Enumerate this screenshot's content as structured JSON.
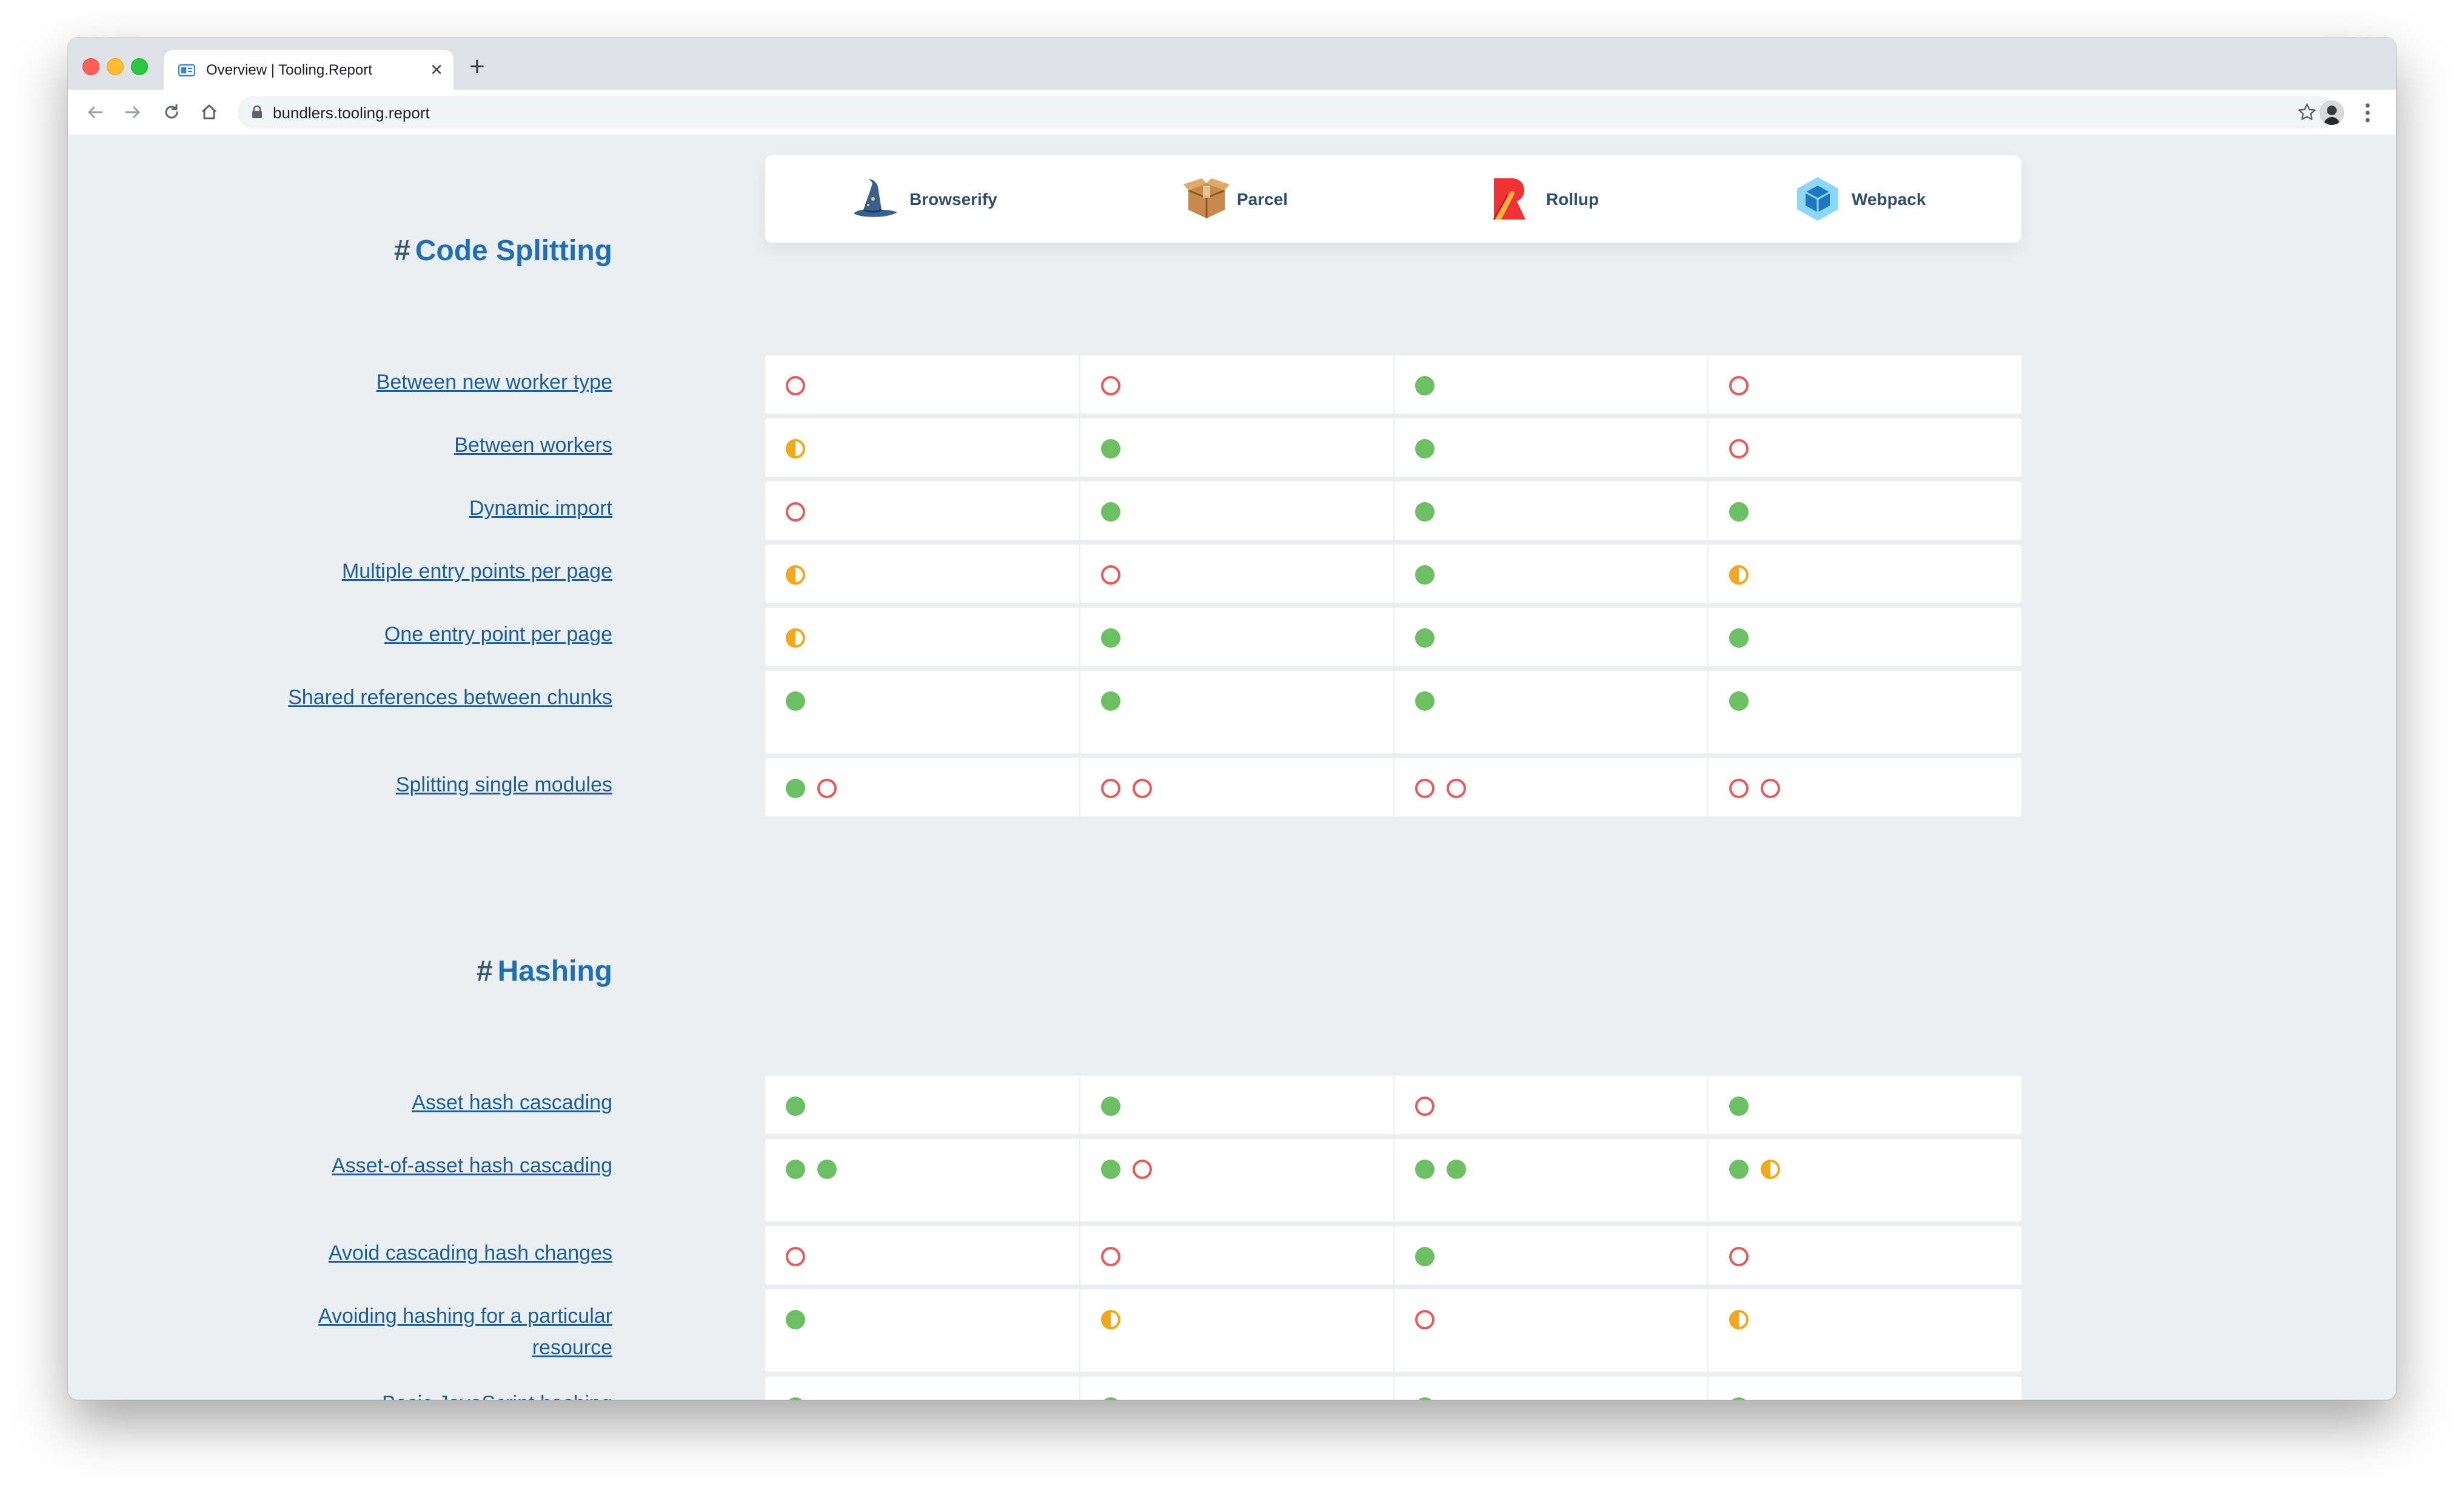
{
  "browser": {
    "tab_title": "Overview | Tooling.Report",
    "new_tab_symbol": "+",
    "close_symbol": "×",
    "url": "bundlers.tooling.report"
  },
  "bundlers": [
    {
      "name": "Browserify",
      "icon": "wizard-hat-icon"
    },
    {
      "name": "Parcel",
      "icon": "box-icon"
    },
    {
      "name": "Rollup",
      "icon": "rollup-icon"
    },
    {
      "name": "Webpack",
      "icon": "cube-icon"
    }
  ],
  "legend_colors": {
    "pass": "#6cc063",
    "fail": "#e65b5b",
    "partial": "#f2a81d"
  },
  "sections": [
    {
      "hash": "#",
      "title": "Code Splitting",
      "rows": [
        {
          "label": "Between new worker type",
          "results": [
            [
              "fail"
            ],
            [
              "fail"
            ],
            [
              "pass"
            ],
            [
              "fail"
            ]
          ]
        },
        {
          "label": "Between workers",
          "results": [
            [
              "partial"
            ],
            [
              "pass"
            ],
            [
              "pass"
            ],
            [
              "fail"
            ]
          ]
        },
        {
          "label": "Dynamic import",
          "results": [
            [
              "fail"
            ],
            [
              "pass"
            ],
            [
              "pass"
            ],
            [
              "pass"
            ]
          ]
        },
        {
          "label": "Multiple entry points per page",
          "results": [
            [
              "partial"
            ],
            [
              "fail"
            ],
            [
              "pass"
            ],
            [
              "partial"
            ]
          ]
        },
        {
          "label": "One entry point per page",
          "results": [
            [
              "partial"
            ],
            [
              "pass"
            ],
            [
              "pass"
            ],
            [
              "pass"
            ]
          ]
        },
        {
          "label": "Shared references between chunks",
          "results": [
            [
              "pass"
            ],
            [
              "pass"
            ],
            [
              "pass"
            ],
            [
              "pass"
            ]
          ]
        },
        {
          "label": "Splitting single modules",
          "results": [
            [
              "pass",
              "fail"
            ],
            [
              "fail",
              "fail"
            ],
            [
              "fail",
              "fail"
            ],
            [
              "fail",
              "fail"
            ]
          ]
        }
      ]
    },
    {
      "hash": "#",
      "title": "Hashing",
      "rows": [
        {
          "label": "Asset hash cascading",
          "results": [
            [
              "pass"
            ],
            [
              "pass"
            ],
            [
              "fail"
            ],
            [
              "pass"
            ]
          ]
        },
        {
          "label": "Asset-of-asset hash cascading",
          "results": [
            [
              "pass",
              "pass"
            ],
            [
              "pass",
              "fail"
            ],
            [
              "pass",
              "pass"
            ],
            [
              "pass",
              "partial"
            ]
          ]
        },
        {
          "label": "Avoid cascading hash changes",
          "results": [
            [
              "fail"
            ],
            [
              "fail"
            ],
            [
              "pass"
            ],
            [
              "fail"
            ]
          ]
        },
        {
          "label": "Avoiding hashing for a particular resource",
          "results": [
            [
              "pass"
            ],
            [
              "partial"
            ],
            [
              "fail"
            ],
            [
              "partial"
            ]
          ]
        },
        {
          "label": "Basic JavaScript hashing",
          "results": [
            [
              "pass"
            ],
            [
              "pass"
            ],
            [
              "pass"
            ],
            [
              "pass"
            ]
          ]
        }
      ]
    }
  ]
}
